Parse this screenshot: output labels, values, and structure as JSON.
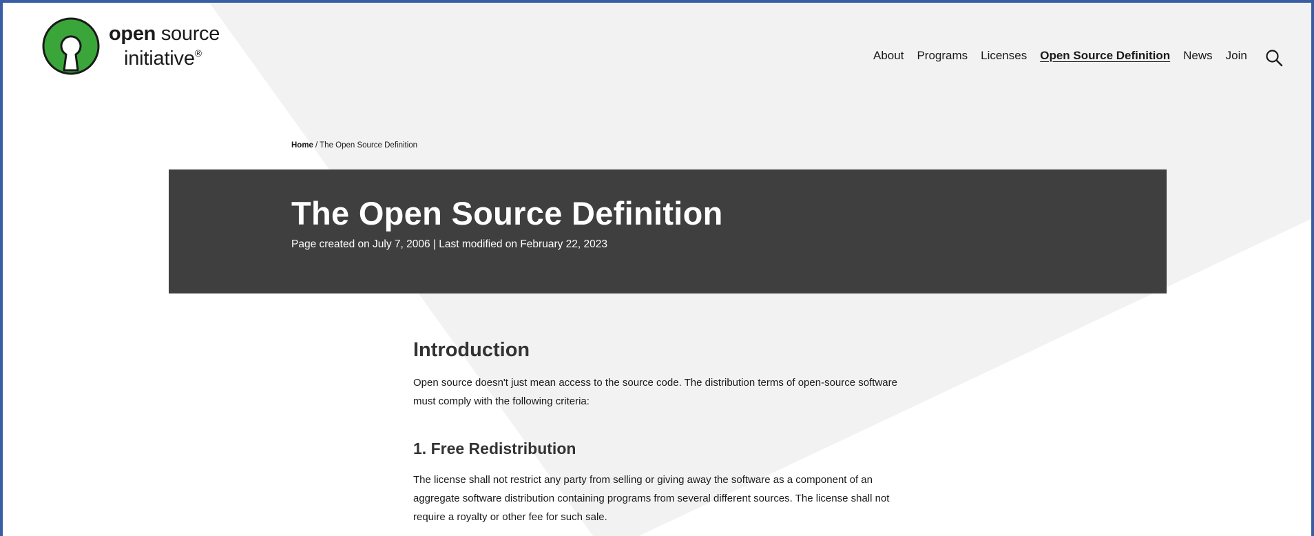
{
  "logo": {
    "brand_bold": "open",
    "brand_rest": " source",
    "brand_line2": "initiative",
    "registered": "®",
    "icon": "osi-keyhole-logo",
    "brand_color": "#3aa63a"
  },
  "nav": {
    "items": [
      {
        "label": "About",
        "active": false
      },
      {
        "label": "Programs",
        "active": false
      },
      {
        "label": "Licenses",
        "active": false
      },
      {
        "label": "Open Source Definition",
        "active": true
      },
      {
        "label": "News",
        "active": false
      },
      {
        "label": "Join",
        "active": false
      }
    ],
    "search_icon": "search-icon"
  },
  "breadcrumb": {
    "home": "Home",
    "separator": "/",
    "current": "The Open Source Definition"
  },
  "hero": {
    "title": "The Open Source Definition",
    "meta": "Page created on July 7, 2006 | Last modified on February 22, 2023",
    "background": "#3f3f3f"
  },
  "content": {
    "intro_heading": "Introduction",
    "intro_text": "Open source doesn't just mean access to the source code. The distribution terms of open-source software must comply with the following criteria:",
    "section1_heading": "1. Free Redistribution",
    "section1_text": "The license shall not restrict any party from selling or giving away the software as a component of an aggregate software distribution containing programs from several different sources. The license shall not require a royalty or other fee for such sale."
  },
  "colors": {
    "frame_border": "#3a5ea4",
    "background_shape": "#f2f2f2"
  }
}
